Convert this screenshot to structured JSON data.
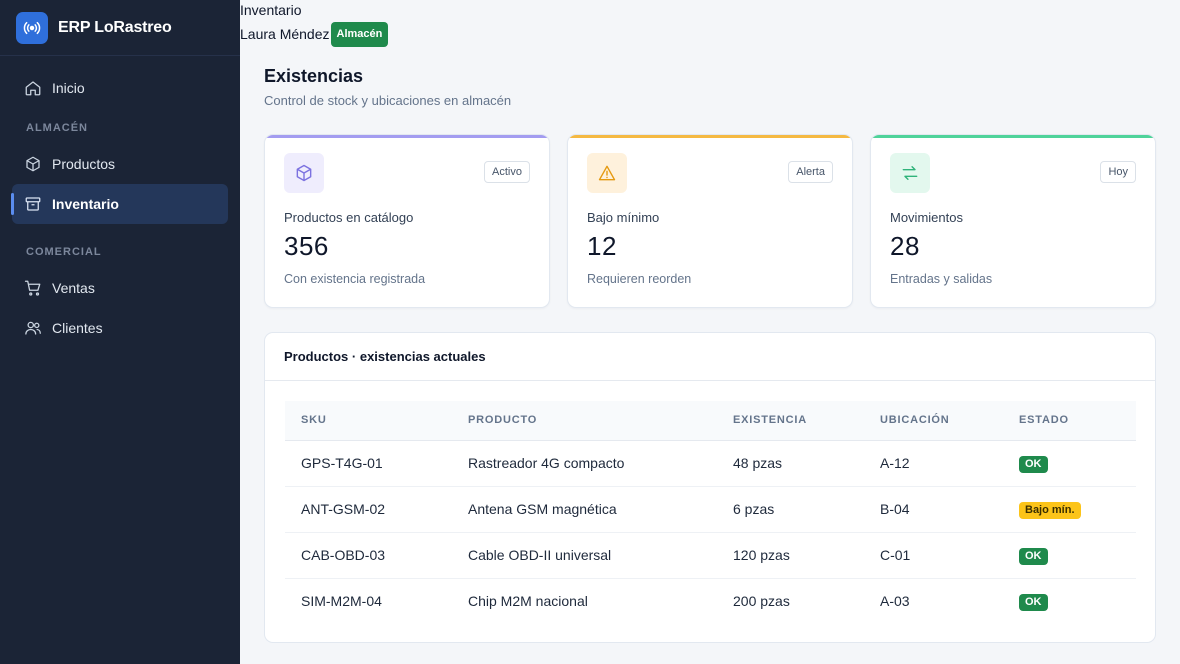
{
  "app": {
    "name": "ERP LoRastreo",
    "logo_icon": "radio-broadcast-icon"
  },
  "sidebar": {
    "home": {
      "label": "Inicio",
      "icon": "home-icon"
    },
    "sections": [
      {
        "title": "ALMACÉN",
        "items": [
          {
            "label": "Productos",
            "icon": "box-icon",
            "active": false
          },
          {
            "label": "Inventario",
            "icon": "archive-icon",
            "active": true
          }
        ]
      },
      {
        "title": "COMERCIAL",
        "items": [
          {
            "label": "Ventas",
            "icon": "cart-icon",
            "active": false
          },
          {
            "label": "Clientes",
            "icon": "users-icon",
            "active": false
          }
        ]
      }
    ]
  },
  "header": {
    "breadcrumb": "Inventario",
    "user_name": "Laura Méndez",
    "user_role": "Almacén"
  },
  "page": {
    "title": "Existencias",
    "subtitle": "Control de stock y ubicaciones en almacén"
  },
  "stats": [
    {
      "label": "Productos en catálogo",
      "value": "356",
      "note": "Con existencia registrada",
      "tag": "Activo",
      "icon": "box-icon",
      "accent": "#a39cf0",
      "tile_bg": "#efedfd",
      "icon_color": "#7c72e0"
    },
    {
      "label": "Bajo mínimo",
      "value": "12",
      "note": "Requieren reorden",
      "tag": "Alerta",
      "icon": "warning-icon",
      "accent": "#f5b942",
      "tile_bg": "#fef1dc",
      "icon_color": "#e59a12"
    },
    {
      "label": "Movimientos",
      "value": "28",
      "note": "Entradas y salidas",
      "tag": "Hoy",
      "icon": "arrows-exchange-icon",
      "accent": "#4fd39a",
      "tile_bg": "#e3f8ee",
      "icon_color": "#2fb37a"
    }
  ],
  "table": {
    "title": "Productos · existencias actuales",
    "columns": [
      "SKU",
      "PRODUCTO",
      "EXISTENCIA",
      "UBICACIÓN",
      "ESTADO"
    ],
    "rows": [
      {
        "sku": "GPS-T4G-01",
        "product": "Rastreador 4G compacto",
        "stock": "48 pzas",
        "location": "A-12",
        "status": "OK",
        "status_type": "ok"
      },
      {
        "sku": "ANT-GSM-02",
        "product": "Antena GSM magnética",
        "stock": "6 pzas",
        "location": "B-04",
        "status": "Bajo mín.",
        "status_type": "low"
      },
      {
        "sku": "CAB-OBD-03",
        "product": "Cable OBD-II universal",
        "stock": "120 pzas",
        "location": "C-01",
        "status": "OK",
        "status_type": "ok"
      },
      {
        "sku": "SIM-M2M-04",
        "product": "Chip M2M nacional",
        "stock": "200 pzas",
        "location": "A-03",
        "status": "OK",
        "status_type": "ok"
      }
    ]
  },
  "colors": {
    "sidebar_bg": "#1b2436",
    "active_item_bg": "#24375a",
    "brand_blue": "#2f6fdb",
    "ok_green": "#1f8a4c",
    "warn_yellow": "#fcc419"
  }
}
